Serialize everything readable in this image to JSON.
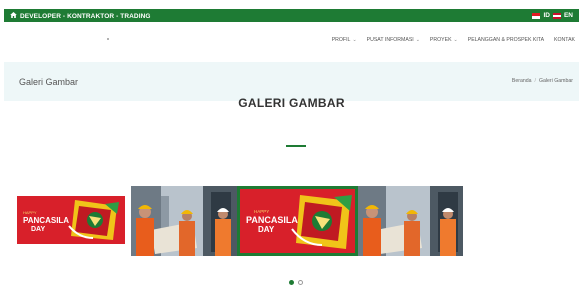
{
  "topbar": {
    "tagline": "DEVELOPER - KONTRAKTOR - TRADING",
    "lang_id": "ID",
    "lang_en": "EN"
  },
  "nav": {
    "items": [
      {
        "label": "PROFIL",
        "dropdown": true
      },
      {
        "label": "PUSAT INFORMASI",
        "dropdown": true
      },
      {
        "label": "PROYEK",
        "dropdown": true
      },
      {
        "label": "PELANGGAN & PROSPEK KITA",
        "dropdown": false
      },
      {
        "label": "KONTAK",
        "dropdown": false
      }
    ]
  },
  "page": {
    "title": "Galeri Gambar",
    "breadcrumb": {
      "home": "Beranda",
      "current": "Galeri Gambar"
    }
  },
  "section": {
    "heading": "GALERI GAMBAR"
  },
  "carousel": {
    "slides": [
      {
        "kind": "pancasila",
        "small": "HAPPY",
        "line1": "PANCASILA",
        "line2": "DAY"
      },
      {
        "kind": "workers"
      },
      {
        "kind": "pancasila",
        "small": "HAPPY",
        "line1": "PANCASILA",
        "line2": "DAY"
      },
      {
        "kind": "workers"
      }
    ],
    "active_slide": 3,
    "page_count": 2,
    "active_page": 1
  },
  "colors": {
    "brand_green": "#1e7b34",
    "banner_red": "#d8202a",
    "band_bg": "#eef7f8"
  }
}
